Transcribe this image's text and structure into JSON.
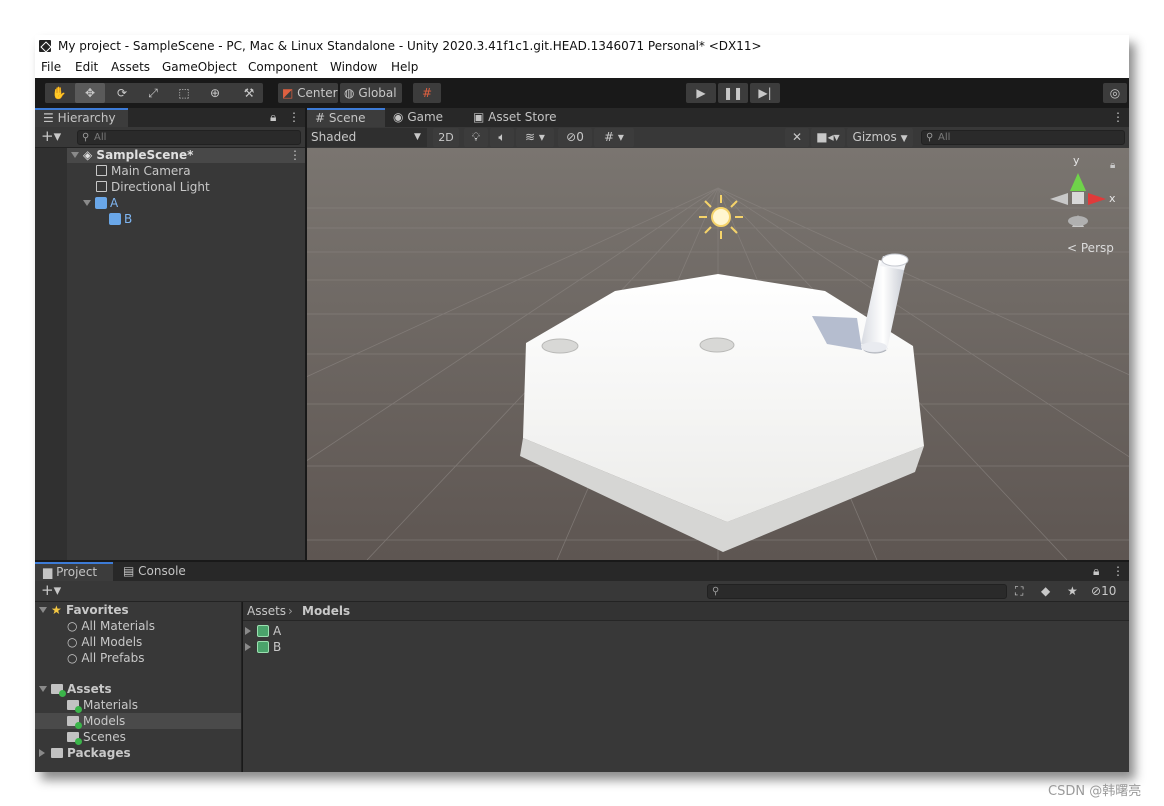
{
  "window": {
    "title": "My project - SampleScene - PC, Mac & Linux Standalone - Unity 2020.3.41f1c1.git.HEAD.1346071 Personal* <DX11>"
  },
  "menu": [
    "File",
    "Edit",
    "Assets",
    "GameObject",
    "Component",
    "Window",
    "Help"
  ],
  "toolbar": {
    "center_label": "Center",
    "global_label": "Global"
  },
  "hierarchy": {
    "tab_label": "Hierarchy",
    "search_placeholder": "All",
    "scene": "SampleScene*",
    "items": [
      "Main Camera",
      "Directional Light",
      "A",
      "B"
    ]
  },
  "scene_tabs": [
    "Scene",
    "Game",
    "Asset Store"
  ],
  "scene_toolbar": {
    "shading": "Shaded",
    "mode_2d": "2D",
    "hidden_count": "0",
    "gizmos": "Gizmos",
    "search_placeholder": "All"
  },
  "viewport": {
    "axis_y": "y",
    "axis_x": "x",
    "projection": "Persp"
  },
  "bottom_tabs": [
    "Project",
    "Console"
  ],
  "project": {
    "favorites_label": "Favorites",
    "favorites": [
      "All Materials",
      "All Models",
      "All Prefabs"
    ],
    "assets_label": "Assets",
    "asset_folders": [
      "Materials",
      "Models",
      "Scenes"
    ],
    "packages_label": "Packages",
    "breadcrumb": [
      "Assets",
      "Models"
    ],
    "files": [
      "A",
      "B"
    ],
    "hidden_count": "10"
  },
  "watermark": "CSDN @韩曙亮"
}
